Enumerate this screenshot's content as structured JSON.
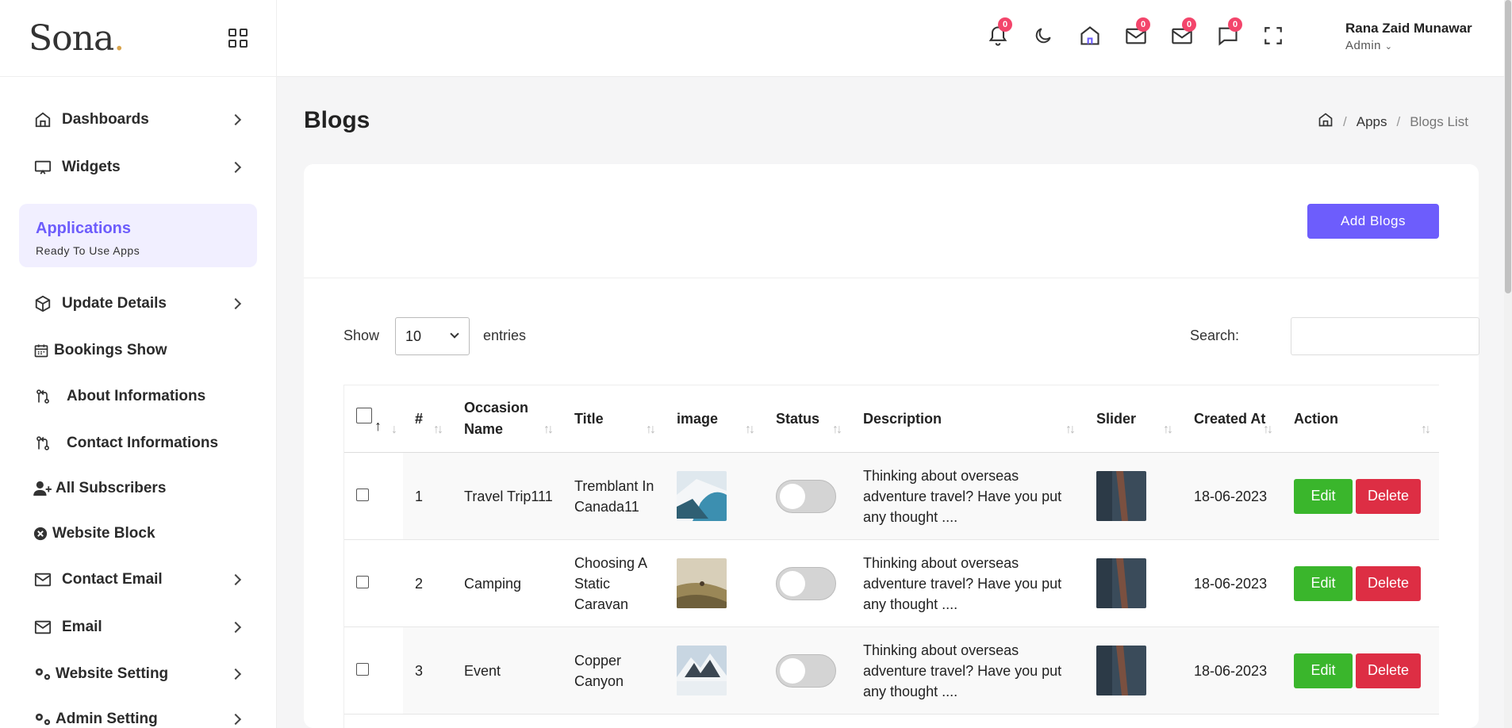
{
  "brand": {
    "name": "Sona",
    "dot": "."
  },
  "sidebar": {
    "items_top": [
      {
        "label": "Dashboards",
        "icon": "home-icon",
        "has_chevron": true
      },
      {
        "label": "Widgets",
        "icon": "monitor-icon",
        "has_chevron": true
      }
    ],
    "app_card": {
      "title": "Applications",
      "subtitle": "Ready To Use Apps"
    },
    "items": [
      {
        "label": "Update Details",
        "icon": "box-icon",
        "has_chevron": true
      },
      {
        "label": "Bookings Show",
        "icon": "calendar-icon",
        "has_chevron": false
      },
      {
        "label": "About Informations",
        "icon": "git-compare-icon",
        "has_chevron": false
      },
      {
        "label": "Contact Informations",
        "icon": "git-compare-icon",
        "has_chevron": false
      },
      {
        "label": "All Subscribers",
        "icon": "user-plus-icon",
        "has_chevron": false
      },
      {
        "label": "Website Block",
        "icon": "x-circle-icon",
        "has_chevron": false
      },
      {
        "label": "Contact Email",
        "icon": "mail-icon",
        "has_chevron": true
      },
      {
        "label": "Email",
        "icon": "mail-icon",
        "has_chevron": true
      },
      {
        "label": "Website Setting",
        "icon": "gears-icon",
        "has_chevron": true
      },
      {
        "label": "Admin Setting",
        "icon": "gears-icon",
        "has_chevron": true
      }
    ]
  },
  "header": {
    "badges": {
      "notifications": "0",
      "messages": "0",
      "mail": "0",
      "chat": "0"
    },
    "user": {
      "name": "Rana Zaid Munawar",
      "role": "Admin"
    }
  },
  "page": {
    "title": "Blogs",
    "breadcrumb": {
      "apps": "Apps",
      "current": "Blogs List",
      "sep": "/"
    },
    "add_button": "Add Blogs"
  },
  "table_controls": {
    "show_label": "Show",
    "entries_value": "10",
    "entries_label": "entries",
    "search_label": "Search:",
    "search_value": ""
  },
  "table": {
    "columns": [
      "#",
      "Occasion Name",
      "Title",
      "image",
      "Status",
      "Description",
      "Slider",
      "Created At",
      "Action"
    ],
    "rows": [
      {
        "num": "1",
        "occasion": "Travel Trip111",
        "title": "Tremblant In Canada11",
        "description": "Thinking about overseas adventure travel? Have you put any thought ....",
        "created": "18-06-2023"
      },
      {
        "num": "2",
        "occasion": "Camping",
        "title": "Choosing A Static Caravan",
        "description": "Thinking about overseas adventure travel? Have you put any thought ....",
        "created": "18-06-2023"
      },
      {
        "num": "3",
        "occasion": "Event",
        "title": "Copper Canyon",
        "description": "Thinking about overseas adventure travel? Have you put any thought ....",
        "created": "18-06-2023"
      }
    ],
    "edit_label": "Edit",
    "delete_label": "Delete"
  },
  "colors": {
    "accent": "#6d5dfc",
    "edit": "#3ab62c",
    "delete": "#dd2e44",
    "badge": "#f3456b"
  }
}
